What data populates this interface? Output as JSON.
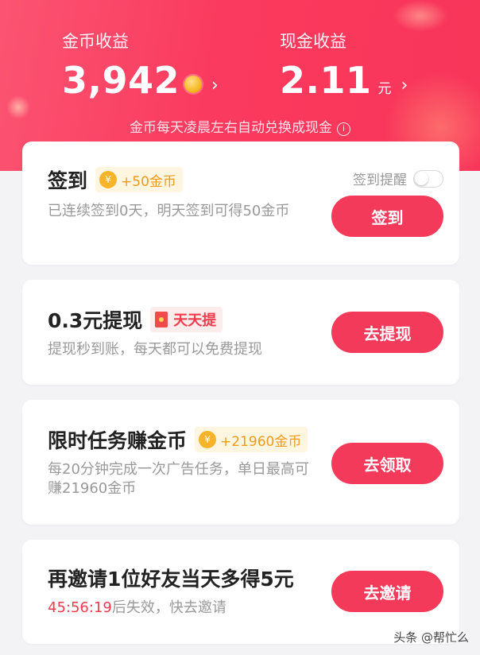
{
  "header": {
    "coin_label": "金币收益",
    "coin_value": "3,942",
    "cash_label": "现金收益",
    "cash_value": "2.11",
    "cash_unit": "元",
    "chevron": "›",
    "note": "金币每天凌晨左右自动兑换成现金",
    "info_icon": "i"
  },
  "checkin": {
    "title": "签到",
    "badge": "+50金币",
    "coin_symbol": "¥",
    "remind_label": "签到提醒",
    "remind_on": false,
    "desc": "已连续签到0天，明天签到可得50金币",
    "button": "签到"
  },
  "withdraw": {
    "title": "0.3元提现",
    "badge": "天天提",
    "desc": "提现秒到账，每天都可以免费提现",
    "button": "去提现"
  },
  "task": {
    "title": "限时任务赚金币",
    "badge": "+21960金币",
    "coin_symbol": "¥",
    "desc": "每20分钟完成一次广告任务，单日最高可赚21960金币",
    "button": "去领取"
  },
  "invite": {
    "title": "再邀请1位好友当天多得5元",
    "countdown": "45:56:19",
    "desc_suffix": "后失效，快去邀请",
    "button": "去邀请"
  },
  "watermark": "头条 @帮忙么",
  "colors": {
    "header": "#fa3a5e",
    "button": "#f43a5a",
    "coin_badge": "#f09a1a",
    "countdown": "#f23b4c"
  }
}
